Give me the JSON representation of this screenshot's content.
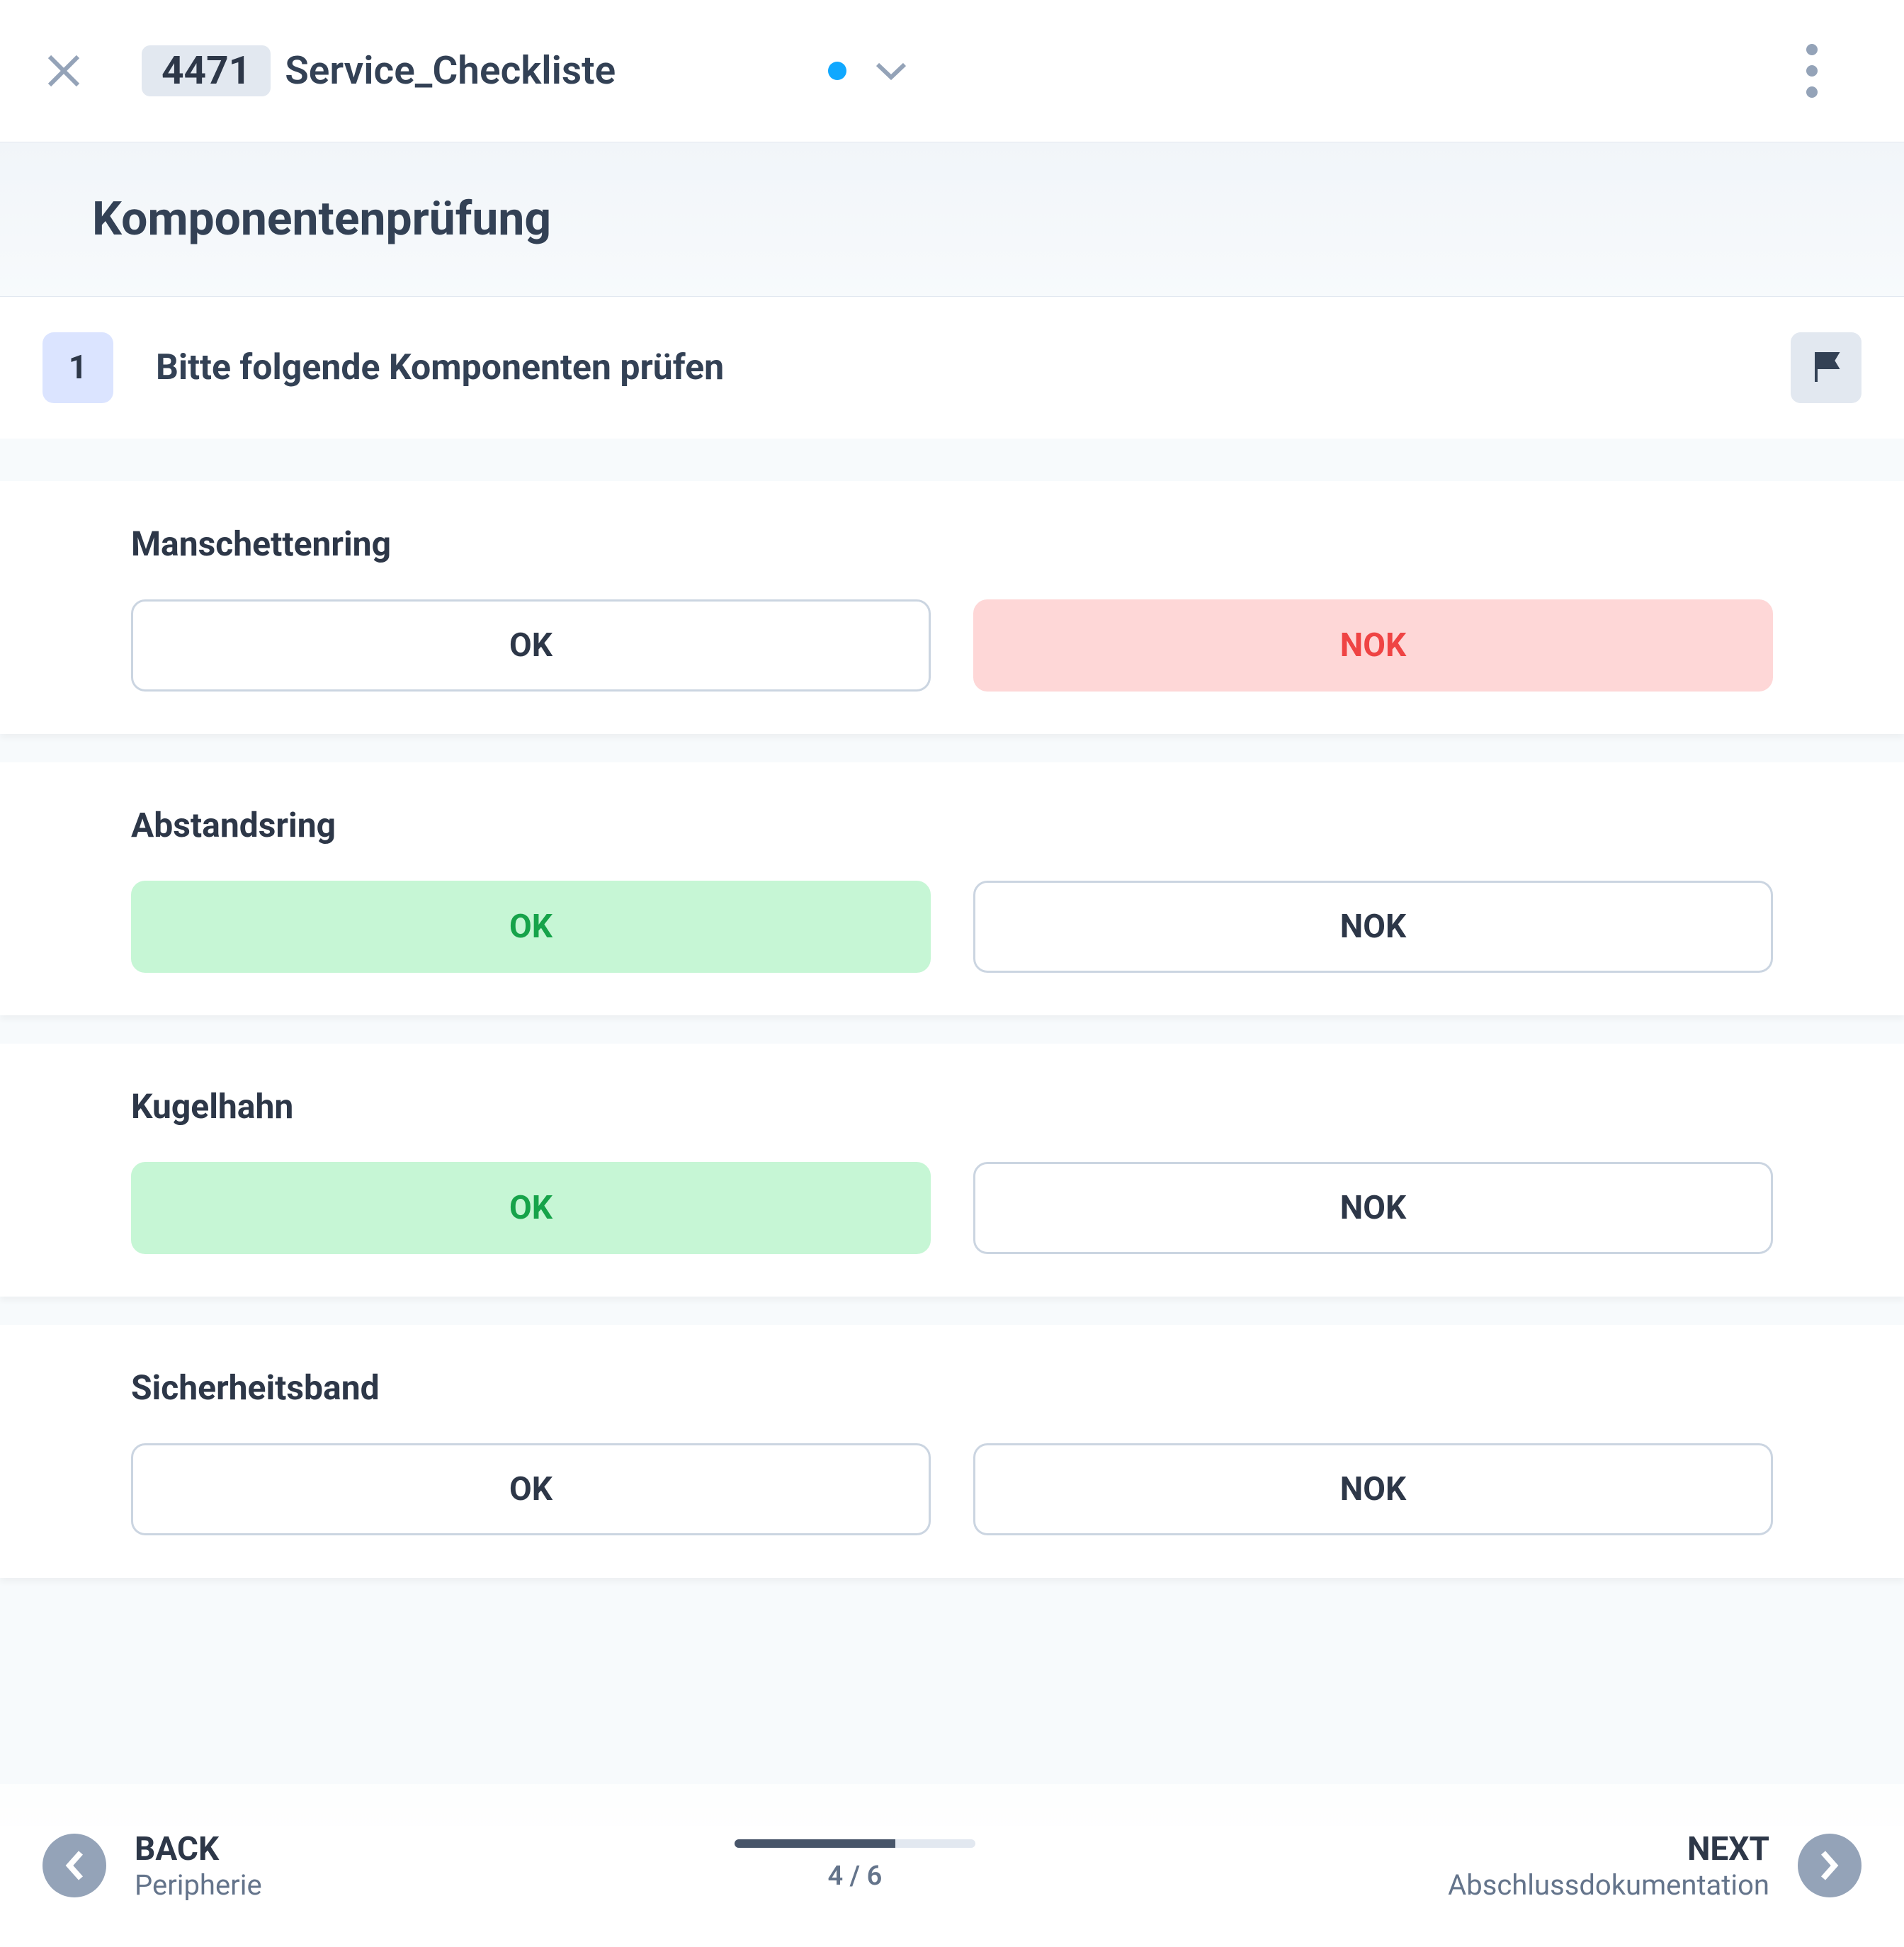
{
  "header": {
    "badge": "4471",
    "title": "Service_Checkliste"
  },
  "section": {
    "title": "Komponentenprüfung"
  },
  "step": {
    "number": "1",
    "text": "Bitte folgende Komponenten prüfen"
  },
  "options": {
    "ok": "OK",
    "nok": "NOK"
  },
  "items": [
    {
      "label": "Manschettenring",
      "selected": "nok"
    },
    {
      "label": "Abstandsring",
      "selected": "ok"
    },
    {
      "label": "Kugelhahn",
      "selected": "ok"
    },
    {
      "label": "Sicherheitsband",
      "selected": null
    }
  ],
  "nav": {
    "back_label": "BACK",
    "back_sub": "Peripherie",
    "next_label": "NEXT",
    "next_sub": "Abschlussdokumentation",
    "page_current": 4,
    "page_total": 6,
    "page_label": "4 / 6"
  }
}
